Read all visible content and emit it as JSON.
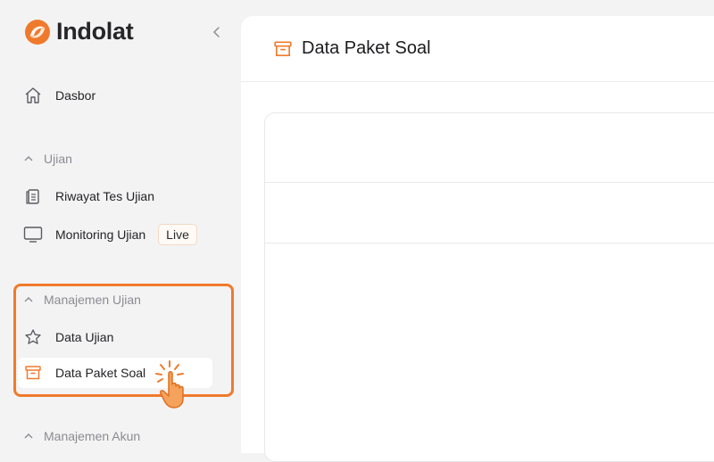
{
  "app": {
    "brand_name": "Indolat",
    "accent_color": "#f07a2c"
  },
  "sidebar": {
    "dashboard": {
      "label": "Dasbor",
      "icon": "home-icon"
    },
    "sections": [
      {
        "label": "Ujian",
        "items": [
          {
            "label": "Riwayat Tes Ujian",
            "icon": "clipboard-icon"
          },
          {
            "label": "Monitoring Ujian",
            "icon": "monitor-icon",
            "badge": "Live"
          }
        ]
      },
      {
        "label": "Manajemen Ujian",
        "items": [
          {
            "label": "Data Ujian",
            "icon": "star-icon"
          },
          {
            "label": "Data Paket Soal",
            "icon": "archive-box-icon",
            "active": true
          }
        ]
      },
      {
        "label": "Manajemen Akun",
        "items": []
      }
    ]
  },
  "main": {
    "title": "Data Paket Soal",
    "title_icon": "archive-box-icon"
  }
}
